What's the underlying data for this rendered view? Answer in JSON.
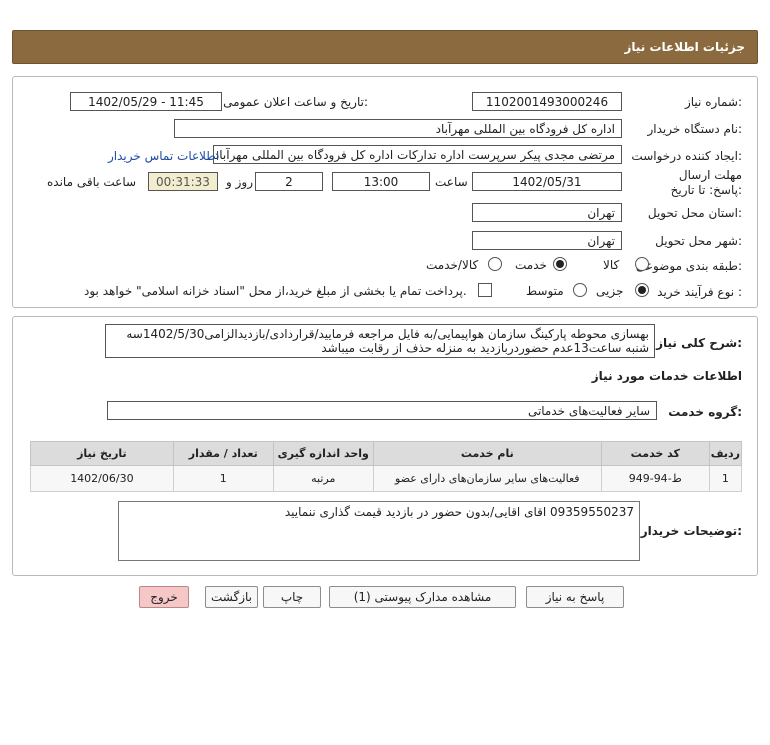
{
  "header": {
    "title": "جزئیات اطلاعات نیاز"
  },
  "need_info": {
    "need_number_label": "شماره نیاز:",
    "need_number": "1102001493000246",
    "announce_label": "تاریخ و ساعت اعلان عمومی:",
    "announce_value": "1402/05/29 - 11:45",
    "buyer_org_label": "نام دستگاه خریدار:",
    "buyer_org": "اداره کل فرودگاه بین المللی مهرآباد",
    "creator_label": "ایجاد کننده درخواست:",
    "creator": "مرتضی مجدی پیکر سرپرست اداره تدارکات  اداره کل فرودگاه بین المللی مهرآباد",
    "contact_link": "اطلاعات تماس خریدار",
    "deadline_label": "مهلت ارسال پاسخ: تا تاریخ:",
    "deadline_date": "1402/05/31",
    "time_label": "ساعت",
    "deadline_time": "13:00",
    "days_value": "2",
    "days_label": "روز و",
    "remaining_time": "00:31:33",
    "remaining_label": "ساعت باقی مانده",
    "province_label": "استان محل تحویل:",
    "province": "تهران",
    "city_label": "شهر محل تحویل:",
    "city": "تهران",
    "category_label": "طبقه بندی موضوعی:",
    "category_options": [
      "کالا",
      "خدمت",
      "کالا/خدمت"
    ],
    "category_selected": "خدمت",
    "process_label": "نوع فرآیند خرید :",
    "process_options": [
      "جزیی",
      "متوسط"
    ],
    "process_selected": "جزیی",
    "treasury_text": "پرداخت تمام یا بخشی از مبلغ خرید،از محل \"اسناد خزانه اسلامی\" خواهد بود."
  },
  "description": {
    "label": "شرح کلی نیاز:",
    "text": "بهسازی محوطه پارکینگ سازمان هواپیمایی/به فایل مراجعه فرمایید/قراردادی/بازدیدالزامی1402/5/30سه شنبه ساعت13عدم حضوردربازدید به منزله حذف از رقابت میباشد"
  },
  "services": {
    "section_title": "اطلاعات خدمات مورد نیاز",
    "group_label": "گروه خدمت:",
    "group_value": "سایر فعالیت‌های خدماتی",
    "columns": [
      "ردیف",
      "کد خدمت",
      "نام خدمت",
      "واحد اندازه گیری",
      "تعداد / مقدار",
      "تاریخ نیاز"
    ],
    "rows": [
      [
        "1",
        "ط-94-949",
        "فعالیت‌های سایر سازمان‌های دارای عضو",
        "مرتبه",
        "1",
        "1402/06/30"
      ]
    ]
  },
  "buyer_notes": {
    "label": "توضیحات خریدار:",
    "text": "09359550237 اقای اقایی/بدون حضور در بازدید قیمت گذاری ننمایید"
  },
  "buttons": {
    "reply": "پاسخ به نیاز",
    "attachments": "مشاهده مدارک پیوستی (1)",
    "print": "چاپ",
    "back": "بازگشت",
    "exit": "خروج"
  },
  "colors": {
    "header_bg": "#8c6a3f",
    "link": "#1d4ca0",
    "exit_button": "#f6c7c7",
    "remaining_bg": "#f3edcf"
  }
}
